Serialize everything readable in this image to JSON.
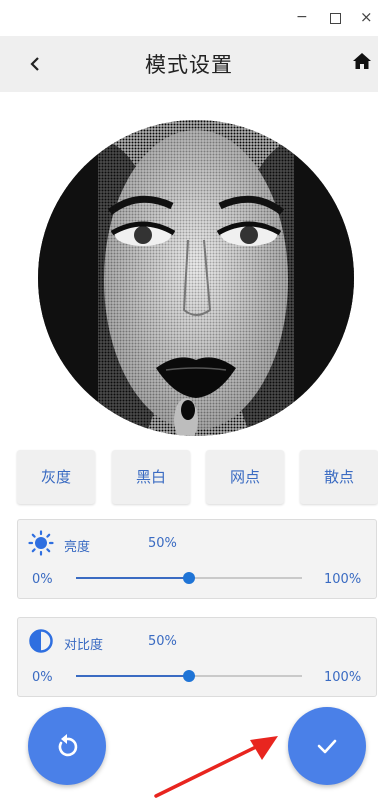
{
  "window": {
    "minimize_label": "−",
    "close_label": "×"
  },
  "header": {
    "title": "模式设置"
  },
  "portrait": {
    "alt": "halftone portrait preview"
  },
  "modes": [
    {
      "label": "灰度"
    },
    {
      "label": "黑白"
    },
    {
      "label": "网点"
    },
    {
      "label": "散点"
    }
  ],
  "brightness": {
    "label": "亮度",
    "value_text": "50%",
    "min": "0%",
    "max": "100%",
    "level": 0.5
  },
  "contrast": {
    "label": "对比度",
    "value_text": "50%",
    "min": "0%",
    "max": "100%",
    "level": 0.5
  },
  "colors": {
    "accent": "#3a6bc2",
    "fab": "#4a80e8",
    "annotation_arrow": "#e8251f"
  }
}
